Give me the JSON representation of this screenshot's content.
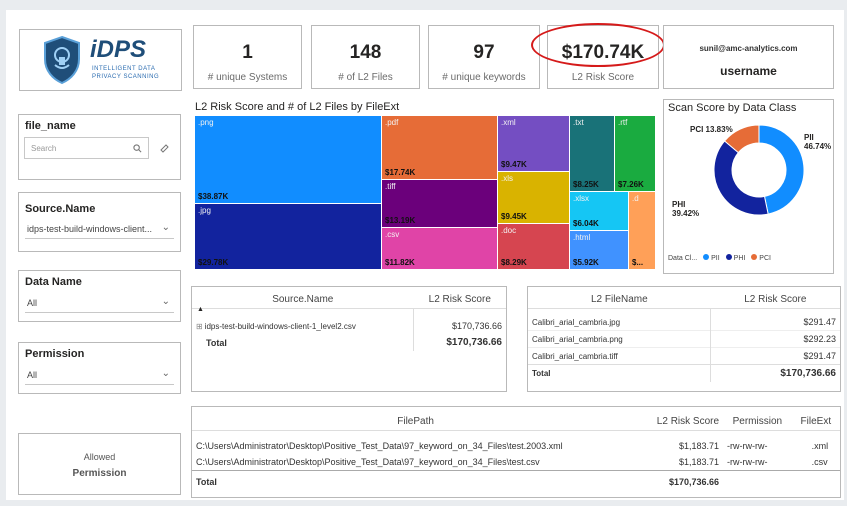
{
  "logo": {
    "brand": "iDPS",
    "line1": "INTELLIGENT DATA",
    "line2": "PRIVACY SCANNING"
  },
  "kpis": [
    {
      "value": "1",
      "label": "# unique Systems"
    },
    {
      "value": "148",
      "label": "# of L2 Files"
    },
    {
      "value": "97",
      "label": "# unique keywords"
    },
    {
      "value": "$170.74K",
      "label": "L2 Risk Score"
    }
  ],
  "user": {
    "email": "sunil@amc-analytics.com",
    "label": "username"
  },
  "slicers": {
    "file_name": {
      "title": "file_name",
      "placeholder": "Search"
    },
    "source_name": {
      "title": "Source.Name",
      "value": "idps-test-build-windows-client..."
    },
    "data_name": {
      "title": "Data Name",
      "value": "All"
    },
    "permission": {
      "title": "Permission",
      "value": "All"
    }
  },
  "allowed_card": {
    "line1": "Allowed",
    "line2": "Permission"
  },
  "treemap": {
    "title": "L2 Risk Score and # of L2 Files by FileExt",
    "tiles": [
      {
        "ext": ".png",
        "value": "$38.87K",
        "color": "#118dff"
      },
      {
        "ext": ".jpg",
        "value": "$29.78K",
        "color": "#12239e"
      },
      {
        "ext": ".pdf",
        "value": "$17.74K",
        "color": "#e66c37"
      },
      {
        "ext": ".tiff",
        "value": "$13.19K",
        "color": "#6b007b"
      },
      {
        "ext": ".csv",
        "value": "$11.82K",
        "color": "#e044a7"
      },
      {
        "ext": ".xml",
        "value": "$9.47K",
        "color": "#744ec2"
      },
      {
        "ext": ".xls",
        "value": "$9.45K",
        "color": "#d9b300"
      },
      {
        "ext": ".doc",
        "value": "$8.29K",
        "color": "#d64550"
      },
      {
        "ext": ".txt",
        "value": "$8.25K",
        "color": "#197278"
      },
      {
        "ext": ".rtf",
        "value": "$7.26K",
        "color": "#1aab40"
      },
      {
        "ext": ".xlsx",
        "value": "$6.04K",
        "color": "#15c6f4"
      },
      {
        "ext": ".html",
        "value": "$5.92K",
        "color": "#4092ff"
      },
      {
        "ext": ".d",
        "value": "$...",
        "color": "#ffa058"
      }
    ]
  },
  "donut": {
    "title": "Scan Score by Data Class",
    "slices": [
      {
        "name": "PII",
        "pct": 46.74,
        "label": "PII 46.74%",
        "color": "#118dff"
      },
      {
        "name": "PHI",
        "pct": 39.42,
        "label": "PHI 39.42%",
        "color": "#12239e"
      },
      {
        "name": "PCI",
        "pct": 13.83,
        "label": "PCI 13.83%",
        "color": "#e66c37"
      }
    ],
    "legend_title": "Data Cl...",
    "legend": [
      "PII",
      "PHI",
      "PCI"
    ]
  },
  "table_source": {
    "headers": [
      "Source.Name",
      "L2 Risk Score"
    ],
    "rows": [
      [
        "idps-test-build-windows-client-1_level2.csv",
        "$170,736.66"
      ]
    ],
    "total": [
      "Total",
      "$170,736.66"
    ]
  },
  "table_files": {
    "headers": [
      "L2 FileName",
      "L2 Risk Score"
    ],
    "rows": [
      [
        "Calibri_arial_cambria.jpg",
        "$291.47"
      ],
      [
        "Calibri_arial_cambria.png",
        "$292.23"
      ],
      [
        "Calibri_arial_cambria.tiff",
        "$291.47"
      ]
    ],
    "total": [
      "Total",
      "$170,736.66"
    ]
  },
  "table_paths": {
    "headers": [
      "FilePath",
      "L2 Risk Score",
      "Permission",
      "FileExt"
    ],
    "rows": [
      [
        "C:\\Users\\Administrator\\Desktop\\Positive_Test_Data\\97_keyword_on_34_Files\\test.2003.xml",
        "$1,183.71",
        "-rw-rw-rw-",
        ".xml"
      ],
      [
        "C:\\Users\\Administrator\\Desktop\\Positive_Test_Data\\97_keyword_on_34_Files\\test.csv",
        "$1,183.71",
        "-rw-rw-rw-",
        ".csv"
      ]
    ],
    "total": [
      "Total",
      "$170,736.66"
    ]
  },
  "colors": {
    "annotation": "#d51a1a",
    "accent": "#118dff"
  }
}
